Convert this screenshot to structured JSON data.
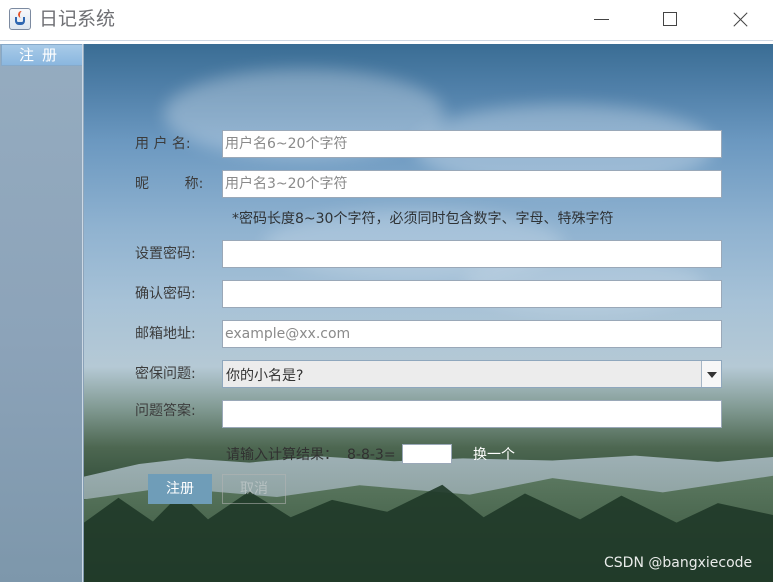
{
  "window": {
    "title": "日记系统",
    "icon": "java-cup-icon",
    "controls": {
      "minimize": "minimize-icon",
      "maximize": "maximize-icon",
      "close": "close-icon"
    }
  },
  "sidebar": {
    "active_tab": "注册"
  },
  "form": {
    "username": {
      "label": "用 户 名:",
      "placeholder": "用户名6~20个字符",
      "value": ""
    },
    "nickname": {
      "label": "昵        称:",
      "placeholder": "用户名3~20个字符",
      "value": ""
    },
    "password_hint": "*密码长度8~30个字符，必须同时包含数字、字母、特殊字符",
    "password": {
      "label": "设置密码:",
      "value": ""
    },
    "confirm_password": {
      "label": "确认密码:",
      "value": ""
    },
    "email": {
      "label": "邮箱地址:",
      "placeholder": "example@xx.com",
      "value": ""
    },
    "security_question": {
      "label": "密保问题:",
      "selected": "你的小名是?"
    },
    "security_answer": {
      "label": "问题答案:",
      "value": ""
    },
    "captcha": {
      "label": "请输入计算结果：",
      "equation": "8-8-3=",
      "value": "",
      "change_label": "换一个"
    },
    "buttons": {
      "register": "注册",
      "cancel": "取消"
    }
  },
  "watermark": "CSDN @bangxiecode",
  "colors": {
    "register_button": "#6f9db8",
    "tab_blue": "#8ab7df"
  }
}
